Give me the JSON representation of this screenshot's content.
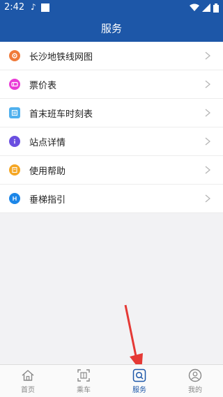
{
  "status_bar": {
    "time": "2:42",
    "note_glyph": "♪"
  },
  "header": {
    "title": "服务"
  },
  "menu": [
    {
      "label": "长沙地铁线网图",
      "icon": "metro-map-icon",
      "color": "#f07a3a"
    },
    {
      "label": "票价表",
      "icon": "ticket-icon",
      "color": "#e93bd6"
    },
    {
      "label": "首末班车时刻表",
      "icon": "timetable-icon",
      "color": "#4fb0ee"
    },
    {
      "label": "站点详情",
      "icon": "info-icon",
      "color": "#6a4fe0"
    },
    {
      "label": "使用帮助",
      "icon": "help-icon",
      "color": "#f5a623"
    },
    {
      "label": "垂梯指引",
      "icon": "elevator-icon",
      "color": "#1c86e8"
    }
  ],
  "bottom_nav": [
    {
      "label": "首页",
      "icon": "home-icon",
      "active": false
    },
    {
      "label": "乘车",
      "icon": "qr-scan-icon",
      "active": false
    },
    {
      "label": "服务",
      "icon": "service-search-icon",
      "active": true
    },
    {
      "label": "我的",
      "icon": "profile-icon",
      "active": false
    }
  ],
  "colors": {
    "primary": "#1d57a8",
    "annotation_arrow": "#e53935"
  }
}
